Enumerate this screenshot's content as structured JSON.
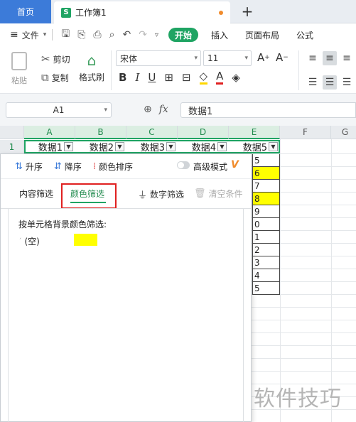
{
  "tabs": {
    "home": "首页",
    "document": "工作簿1",
    "add": "+"
  },
  "menu": {
    "file": "文件",
    "ribbon_tabs": [
      "开始",
      "插入",
      "页面布局",
      "公式"
    ]
  },
  "ribbon": {
    "paste": "粘贴",
    "cut": "剪切",
    "copy": "复制",
    "format_painter": "格式刷",
    "font_name": "宋体",
    "font_size": "11"
  },
  "formula_bar": {
    "cell_ref": "A1",
    "content": "数据1",
    "fx": "fx"
  },
  "sheet": {
    "columns": [
      "A",
      "B",
      "C",
      "D",
      "E",
      "F",
      "G"
    ],
    "row1_label": "1",
    "headers": [
      "数据1",
      "数据2",
      "数据3",
      "数据4",
      "数据5"
    ],
    "visible_e_values": [
      "5",
      "6",
      "7",
      "8",
      "9",
      "0",
      "1",
      "2",
      "3",
      "4",
      "5"
    ],
    "highlight_color": "#ffff00",
    "accent_color": "#1fa463"
  },
  "filter_panel": {
    "sort_asc": "升序",
    "sort_desc": "降序",
    "sort_color": "颜色排序",
    "advanced_mode": "高级模式",
    "vip": "V",
    "tab_content": "内容筛选",
    "tab_color": "颜色筛选",
    "number_filter": "数字筛选",
    "clear": "清空条件",
    "body_title": "按单元格背景颜色筛选:",
    "empty_option": "(空)"
  },
  "watermark": "软件技巧"
}
